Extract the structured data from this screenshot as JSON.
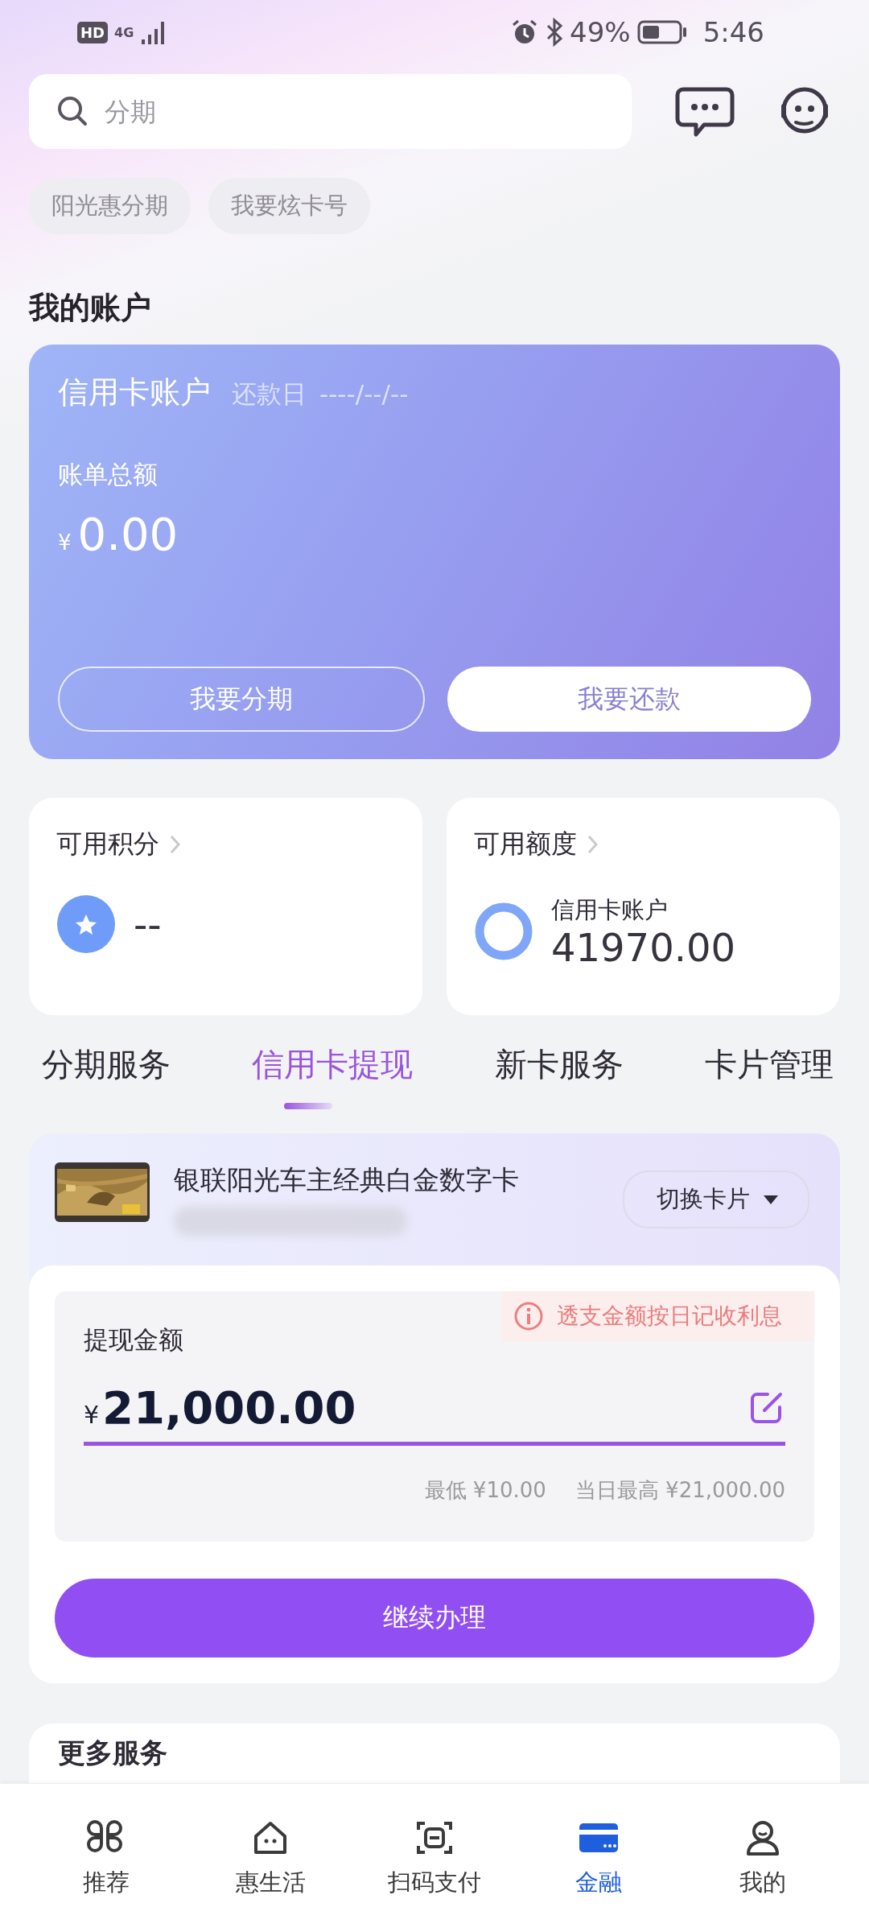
{
  "status_bar": {
    "hd": "HD",
    "network": "4G",
    "battery": "49%",
    "time": "5:46"
  },
  "search": {
    "placeholder": "分期"
  },
  "chips": [
    "阳光惠分期",
    "我要炫卡号"
  ],
  "section_title": "我的账户",
  "account_card": {
    "title": "信用卡账户",
    "due_label": "还款日",
    "due_date": "----/--/--",
    "total_label": "账单总额",
    "currency": "¥",
    "amount": "0.00",
    "buttons": [
      {
        "label": "我要分期",
        "kind": "outline"
      },
      {
        "label": "我要还款",
        "kind": "solid"
      }
    ]
  },
  "summary_cards": [
    {
      "title": "可用积分",
      "kind": "points",
      "value": "--"
    },
    {
      "title": "可用额度",
      "kind": "credit",
      "sublabel": "信用卡账户",
      "value": "41970.00"
    }
  ],
  "tabs": [
    {
      "label": "分期服务",
      "selected": false
    },
    {
      "label": "信用卡提现",
      "selected": true
    },
    {
      "label": "新卡服务",
      "selected": false
    },
    {
      "label": "卡片管理",
      "selected": false
    }
  ],
  "withdraw": {
    "card_name": "银联阳光车主经典白金数字卡",
    "switch_button": "切换卡片",
    "amount_label": "提现金额",
    "notice": "透支金额按日记收利息",
    "currency": "¥",
    "amount": "21,000.00",
    "min": "最低 ¥10.00",
    "max": "当日最高 ¥21,000.00",
    "submit": "继续办理"
  },
  "more_services": {
    "title": "更多服务"
  },
  "bottom_nav": [
    {
      "label": "推荐",
      "selected": false
    },
    {
      "label": "惠生活",
      "selected": false
    },
    {
      "label": "扫码支付",
      "selected": false
    },
    {
      "label": "金融",
      "selected": true
    },
    {
      "label": "我的",
      "selected": false
    }
  ]
}
